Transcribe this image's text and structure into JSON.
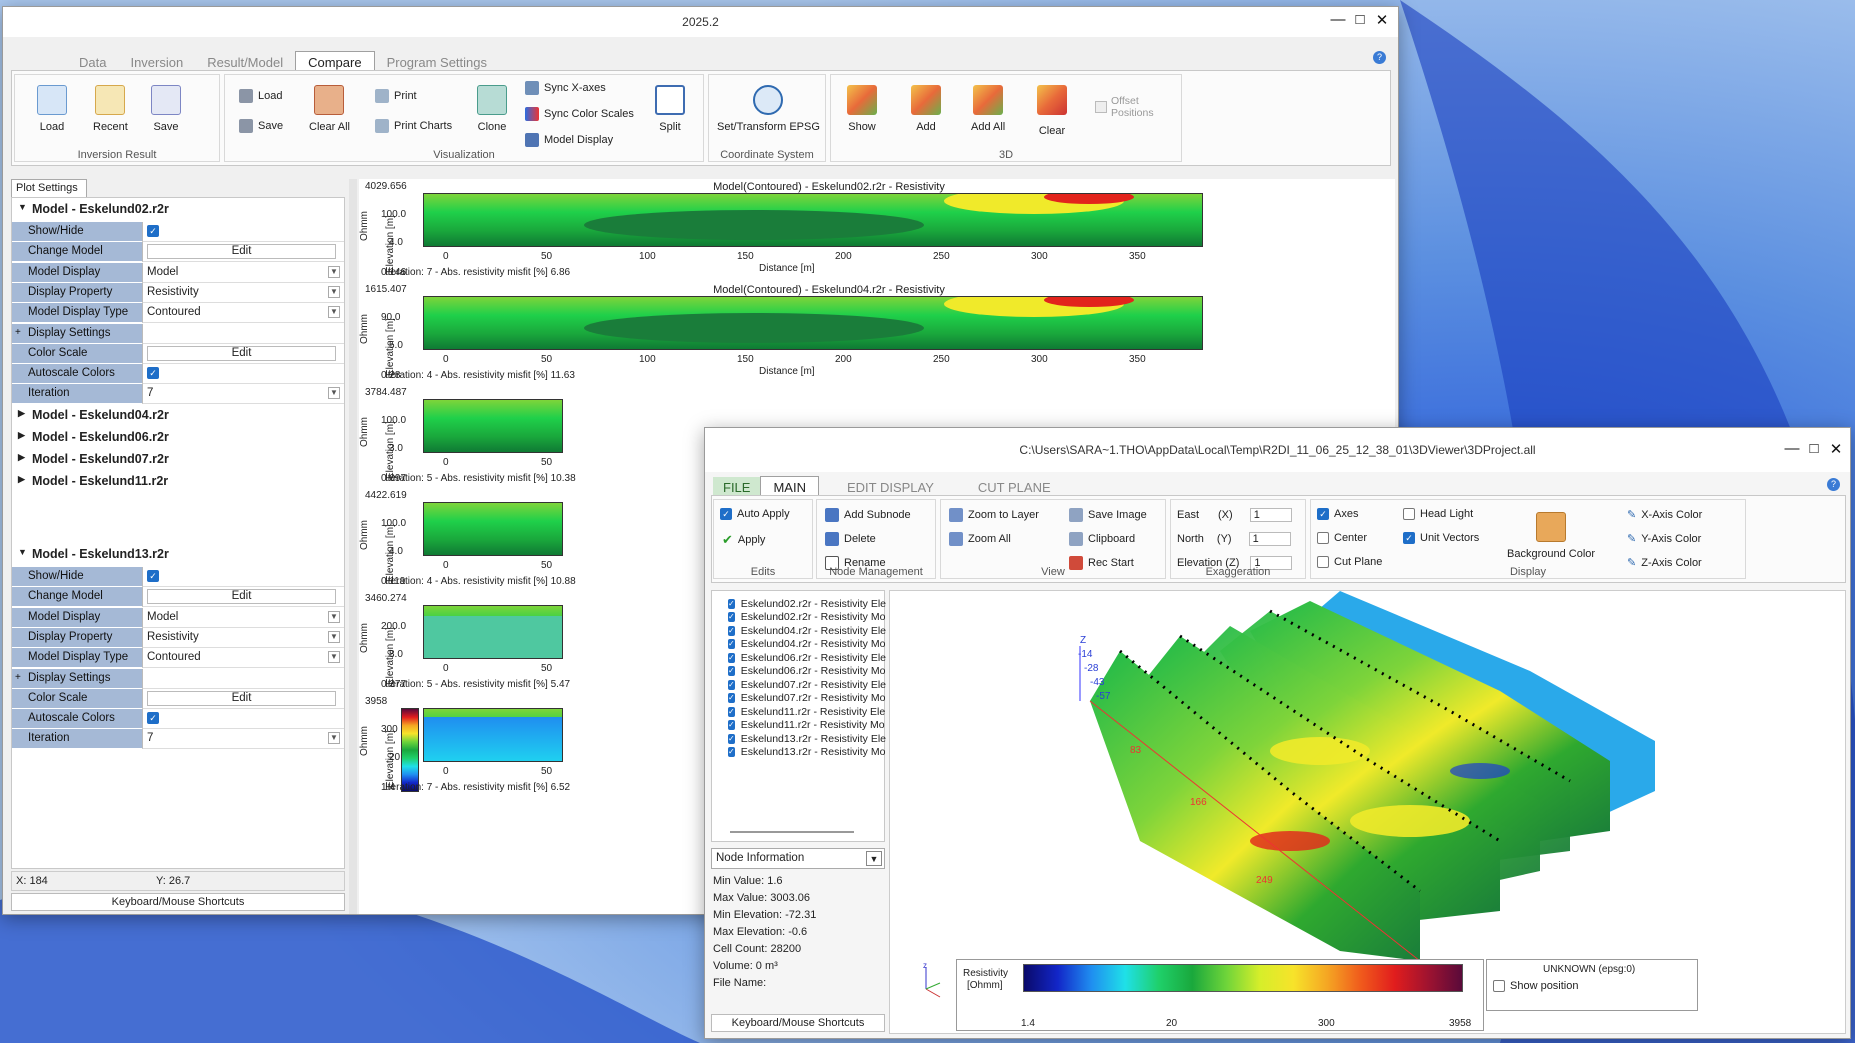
{
  "main_window": {
    "title": "2025.2",
    "tabs": [
      "Data",
      "Inversion",
      "Result/Model",
      "Compare",
      "Program Settings"
    ],
    "active_tab": "Compare",
    "groups": {
      "inversion_result": {
        "label": "Inversion Result",
        "load": "Load",
        "recent": "Recent",
        "save": "Save"
      },
      "visualization": {
        "label": "Visualization",
        "load": "Load",
        "save": "Save",
        "clear_all": "Clear All",
        "print": "Print",
        "print_charts": "Print Charts",
        "clone": "Clone",
        "sync_x": "Sync X-axes",
        "sync_color": "Sync Color Scales",
        "model_display": "Model Display",
        "split": "Split"
      },
      "coordinate": {
        "label": "Coordinate System",
        "set_transform": "Set/Transform EPSG"
      },
      "three_d": {
        "label": "3D",
        "show": "Show",
        "add": "Add",
        "add_all": "Add All",
        "clear": "Clear",
        "offset": "Offset",
        "positions": "Positions"
      }
    },
    "plot_settings": {
      "tab_label": "Plot Settings",
      "model1": {
        "header": "Model - Eskelund02.r2r",
        "rows": [
          {
            "k": "Show/Hide",
            "v": ""
          },
          {
            "k": "Change Model",
            "v": "Edit"
          },
          {
            "k": "Model Display",
            "v": "Model"
          },
          {
            "k": "Display Property",
            "v": "Resistivity"
          },
          {
            "k": "Model Display Type",
            "v": "Contoured"
          },
          {
            "k": "Display Settings",
            "v": ""
          },
          {
            "k": "Color Scale",
            "v": "Edit"
          },
          {
            "k": "Autoscale Colors",
            "v": ""
          },
          {
            "k": "Iteration",
            "v": "7"
          }
        ]
      },
      "collapsed": [
        "Model - Eskelund04.r2r",
        "Model - Eskelund06.r2r",
        "Model - Eskelund07.r2r",
        "Model - Eskelund11.r2r"
      ],
      "model2": {
        "header": "Model - Eskelund13.r2r",
        "rows": [
          {
            "k": "Show/Hide",
            "v": ""
          },
          {
            "k": "Change Model",
            "v": "Edit"
          },
          {
            "k": "Model Display",
            "v": "Model"
          },
          {
            "k": "Display Property",
            "v": "Resistivity"
          },
          {
            "k": "Model Display Type",
            "v": "Contoured"
          },
          {
            "k": "Display Settings",
            "v": ""
          },
          {
            "k": "Color Scale",
            "v": "Edit"
          },
          {
            "k": "Autoscale Colors",
            "v": ""
          },
          {
            "k": "Iteration",
            "v": "7"
          }
        ]
      },
      "x_readout": "X: 184",
      "y_readout": "Y: 26.7",
      "shortcuts": "Keyboard/Mouse Shortcuts"
    },
    "plots": [
      {
        "title": "Model(Contoured) - Eskelund02.r2r - Resistivity",
        "max": "4029.656",
        "mid": "100.0",
        "low": "4.0",
        "min": "0.146",
        "iteration": "Iteration: 7 - Abs. resistivity misfit [%] 6.86"
      },
      {
        "title": "Model(Contoured) - Eskelund04.r2r - Resistivity",
        "max": "1615.407",
        "mid": "90.0",
        "low": "5.0",
        "min": "0.28",
        "iteration": "Iteration: 4 - Abs. resistivity misfit [%] 11.63"
      },
      {
        "title": "",
        "max": "3784.487",
        "mid": "100.0",
        "low": "3.0",
        "min": "0.097",
        "iteration": "Iteration: 5 - Abs. resistivity misfit [%] 10.38"
      },
      {
        "title": "",
        "max": "4422.619",
        "mid": "100.0",
        "low": "4.0",
        "min": "0.119",
        "iteration": "Iteration: 4 - Abs. resistivity misfit [%] 10.88"
      },
      {
        "title": "",
        "max": "3460.274",
        "mid": "200.0",
        "low": "8.0",
        "min": "0.377",
        "iteration": "Iteration: 5 - Abs. resistivity misfit [%] 5.47"
      },
      {
        "title": "",
        "max": "3958",
        "mid": "300",
        "low": "20",
        "min": "1.4",
        "iteration": "Iteration: 7 - Abs. resistivity misfit [%] 6.52"
      }
    ],
    "axis": {
      "ohmm": "Ohmm",
      "elev": "Elevation [m]",
      "dist": "Distance [m]",
      "xticks": [
        "0",
        "50",
        "100",
        "150",
        "200",
        "250",
        "300",
        "350"
      ]
    }
  },
  "viewer": {
    "title": "C:\\Users\\SARA~1.THO\\AppData\\Local\\Temp\\R2DI_11_06_25_12_38_01\\3DViewer\\3DProject.all",
    "tabs": [
      "FILE",
      "MAIN",
      "EDIT DISPLAY",
      "CUT PLANE"
    ],
    "edits": {
      "label": "Edits",
      "auto_apply": "Auto Apply",
      "apply": "Apply"
    },
    "node": {
      "label": "Node Management",
      "add_subnode": "Add Subnode",
      "delete": "Delete",
      "rename": "Rename"
    },
    "view": {
      "label": "View",
      "zoom_layer": "Zoom to Layer",
      "zoom_all": "Zoom All",
      "save_image": "Save Image",
      "clipboard": "Clipboard",
      "rec_start": "Rec Start"
    },
    "exag": {
      "label": "Exaggeration",
      "east": "East",
      "north": "North",
      "elev": "Elevation (Z)",
      "ex": "(X)",
      "ny": "(Y)",
      "val": "1"
    },
    "display": {
      "label": "Display",
      "axes": "Axes",
      "center": "Center",
      "cut_plane": "Cut Plane",
      "head_light": "Head Light",
      "unit_vectors": "Unit Vectors",
      "bg_color": "Background Color",
      "x_color": "X-Axis Color",
      "y_color": "Y-Axis Color",
      "z_color": "Z-Axis Color"
    },
    "tree": [
      "Eskelund02.r2r - Resistivity Ele",
      "Eskelund02.r2r - Resistivity Mo",
      "Eskelund04.r2r - Resistivity Ele",
      "Eskelund04.r2r - Resistivity Mo",
      "Eskelund06.r2r - Resistivity Ele",
      "Eskelund06.r2r - Resistivity Mo",
      "Eskelund07.r2r - Resistivity Ele",
      "Eskelund07.r2r - Resistivity Mo",
      "Eskelund11.r2r - Resistivity Ele",
      "Eskelund11.r2r - Resistivity Mo",
      "Eskelund13.r2r - Resistivity Ele",
      "Eskelund13.r2r - Resistivity Mo"
    ],
    "node_info": "Node Information",
    "info": [
      "Min Value: 1.6",
      "Max Value: 3003.06",
      "Min Elevation: -72.31",
      "Max Elevation: -0.6",
      "Cell Count: 28200",
      "Volume: 0 m³",
      "File Name:"
    ],
    "shortcuts": "Keyboard/Mouse Shortcuts",
    "z_axis": {
      "z": "Z",
      "t1": "-14",
      "t2": "-28",
      "t3": "-43",
      "t4": "-57"
    },
    "dist_labels": [
      "83",
      "166",
      "249"
    ],
    "legend": {
      "title": "Resistivity",
      "unit": "[Ohmm]",
      "min": "1.4",
      "t1": "20",
      "t2": "300",
      "max": "3958"
    },
    "crs": {
      "text": "UNKNOWN (epsg:0)",
      "show_pos": "Show position"
    }
  }
}
